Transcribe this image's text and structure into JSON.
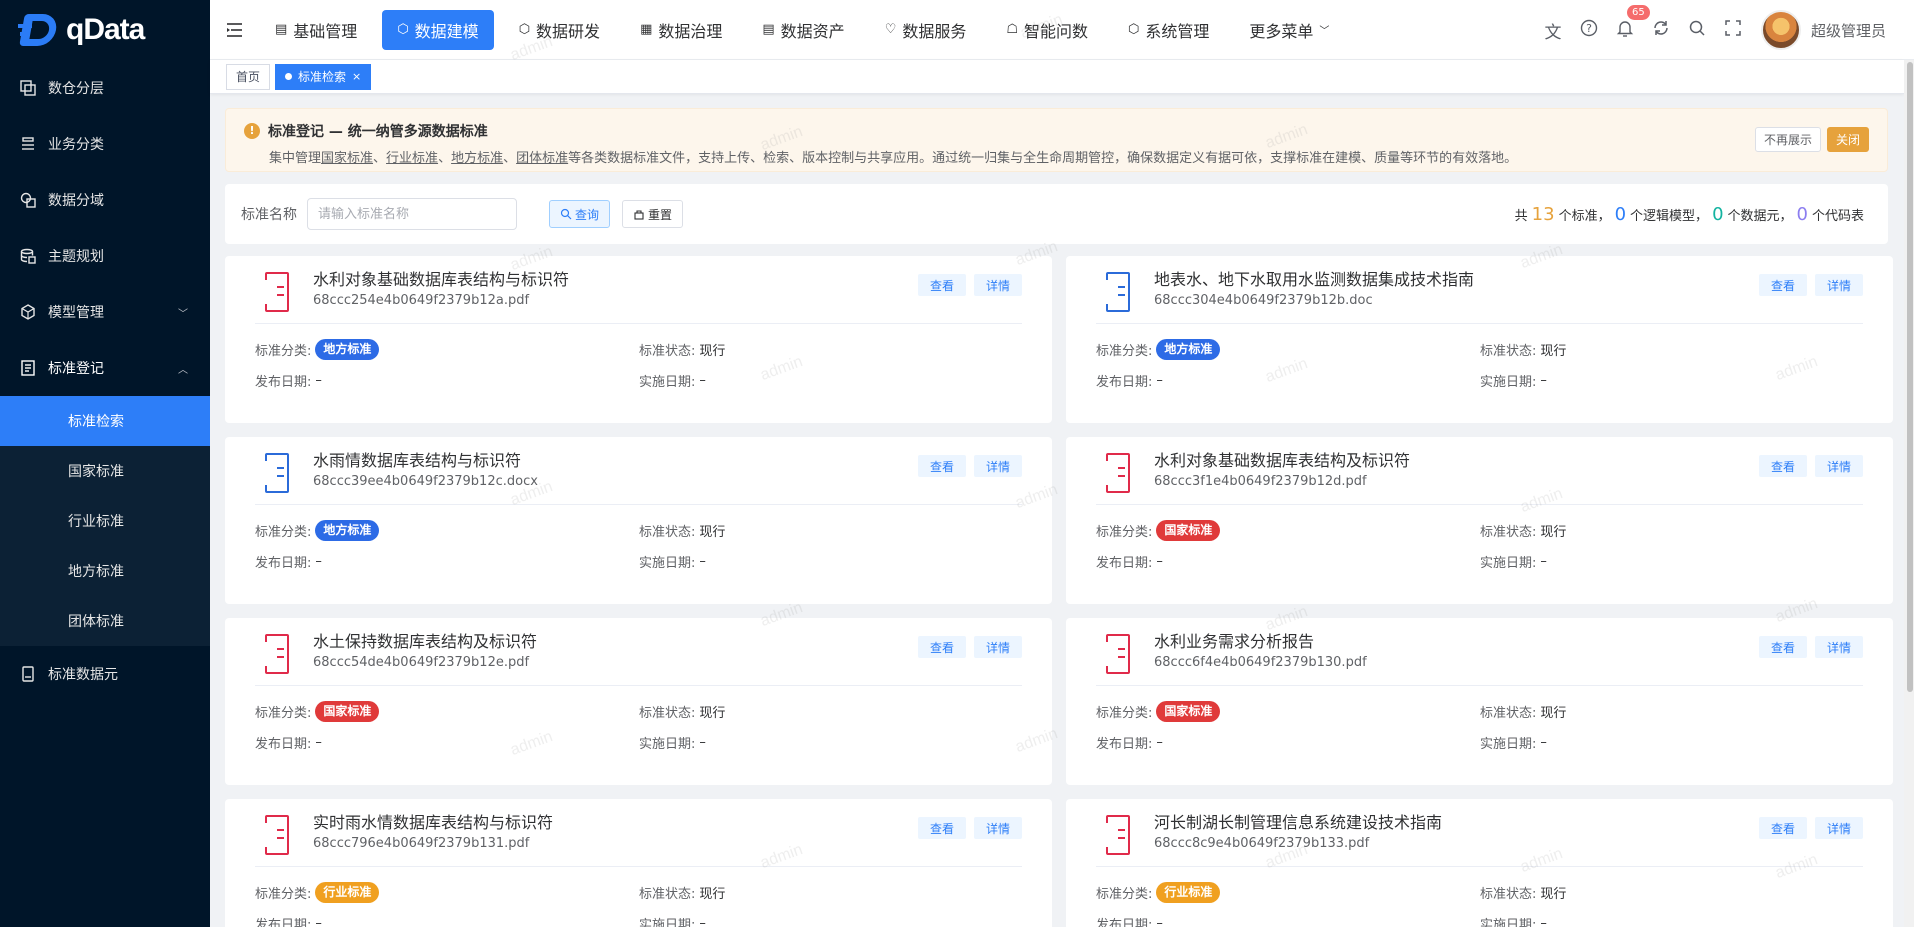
{
  "brand": {
    "name": "qData"
  },
  "sidebar": {
    "items": [
      {
        "label": "数仓分层",
        "icon": "layers-icon"
      },
      {
        "label": "业务分类",
        "icon": "list-icon"
      },
      {
        "label": "数据分域",
        "icon": "domain-icon"
      },
      {
        "label": "主题规划",
        "icon": "database-icon"
      },
      {
        "label": "模型管理",
        "icon": "cube-icon",
        "arrow": "﹀"
      },
      {
        "label": "标准登记",
        "icon": "register-icon",
        "arrow": "︿"
      }
    ],
    "subitems": [
      "标准检索",
      "国家标准",
      "行业标准",
      "地方标准",
      "团体标准"
    ],
    "last_item": {
      "label": "标准数据元",
      "icon": "data-element-icon"
    }
  },
  "header": {
    "nav": [
      {
        "label": "基础管理",
        "icon": "▤"
      },
      {
        "label": "数据建模",
        "icon": "⬡"
      },
      {
        "label": "数据研发",
        "icon": "⬡"
      },
      {
        "label": "数据治理",
        "icon": "▦"
      },
      {
        "label": "数据资产",
        "icon": "▤"
      },
      {
        "label": "数据服务",
        "icon": "♡"
      },
      {
        "label": "智能问数",
        "icon": "☖"
      },
      {
        "label": "系统管理",
        "icon": "⬡"
      },
      {
        "label": "更多菜单",
        "icon": ""
      }
    ],
    "badge": "65",
    "username": "超级管理员"
  },
  "tabs": [
    {
      "label": "首页"
    },
    {
      "label": "标准检索",
      "close": "×"
    }
  ],
  "notice": {
    "title": "标准登记 — 统一纳管多源数据标准",
    "desc_prefix": "集中管理",
    "links": [
      "国家标准",
      "行业标准",
      "地方标准",
      "团体标准"
    ],
    "separator": "、",
    "desc_suffix": "等各类数据标准文件，支持上传、检索、版本控制与共享应用。通过统一归集与全生命周期管控，确保数据定义有据可依，支撑标准在建模、质量等环节的有效落地。",
    "dismiss_label": "不再展示",
    "close_label": "关闭"
  },
  "search": {
    "label": "标准名称",
    "placeholder": "请输入标准名称",
    "query_label": "查询",
    "reset_label": "重置"
  },
  "stats": {
    "prefix": "共",
    "standards": "13",
    "standards_label": "个标准，",
    "models": "0",
    "models_label": "个逻辑模型，",
    "elements": "0",
    "elements_label": "个数据元，",
    "codes": "0",
    "codes_label": "个代码表",
    "colors": {
      "standards": "#e6a23c",
      "models": "#2d7ef8",
      "elements": "#13b3a0",
      "codes": "#8c7ef0"
    }
  },
  "card_labels": {
    "view": "查看",
    "detail": "详情",
    "category": "标准分类:",
    "status": "标准状态:",
    "publish": "发布日期:",
    "implement": "实施日期:"
  },
  "category_colors": {
    "地方标准": "#2d6be6",
    "国家标准": "#e03a3a",
    "行业标准": "#f0a020"
  },
  "cards": [
    {
      "title": "水利对象基础数据库表结构与标识符",
      "file": "68ccc254e4b0649f2379b12a.pdf",
      "type": "pdf",
      "category": "地方标准",
      "status": "现行",
      "publish": "–",
      "implement": "–"
    },
    {
      "title": "地表水、地下水取用水监测数据集成技术指南",
      "file": "68ccc304e4b0649f2379b12b.doc",
      "type": "doc",
      "category": "地方标准",
      "status": "现行",
      "publish": "–",
      "implement": "–"
    },
    {
      "title": "水雨情数据库表结构与标识符",
      "file": "68ccc39ee4b0649f2379b12c.docx",
      "type": "doc",
      "category": "地方标准",
      "status": "现行",
      "publish": "–",
      "implement": "–"
    },
    {
      "title": "水利对象基础数据库表结构及标识符",
      "file": "68ccc3f1e4b0649f2379b12d.pdf",
      "type": "pdf",
      "category": "国家标准",
      "status": "现行",
      "publish": "–",
      "implement": "–"
    },
    {
      "title": "水土保持数据库表结构及标识符",
      "file": "68ccc54de4b0649f2379b12e.pdf",
      "type": "pdf",
      "category": "国家标准",
      "status": "现行",
      "publish": "–",
      "implement": "–"
    },
    {
      "title": "水利业务需求分析报告",
      "file": "68ccc6f4e4b0649f2379b130.pdf",
      "type": "pdf",
      "category": "国家标准",
      "status": "现行",
      "publish": "–",
      "implement": "–"
    },
    {
      "title": "实时雨水情数据库表结构与标识符",
      "file": "68ccc796e4b0649f2379b131.pdf",
      "type": "pdf",
      "category": "行业标准",
      "status": "现行",
      "publish": "–",
      "implement": "–"
    },
    {
      "title": "河长制湖长制管理信息系统建设技术指南",
      "file": "68ccc8c9e4b0649f2379b133.pdf",
      "type": "pdf",
      "category": "行业标准",
      "status": "现行",
      "publish": "–",
      "implement": "–"
    }
  ],
  "watermark": "admin"
}
